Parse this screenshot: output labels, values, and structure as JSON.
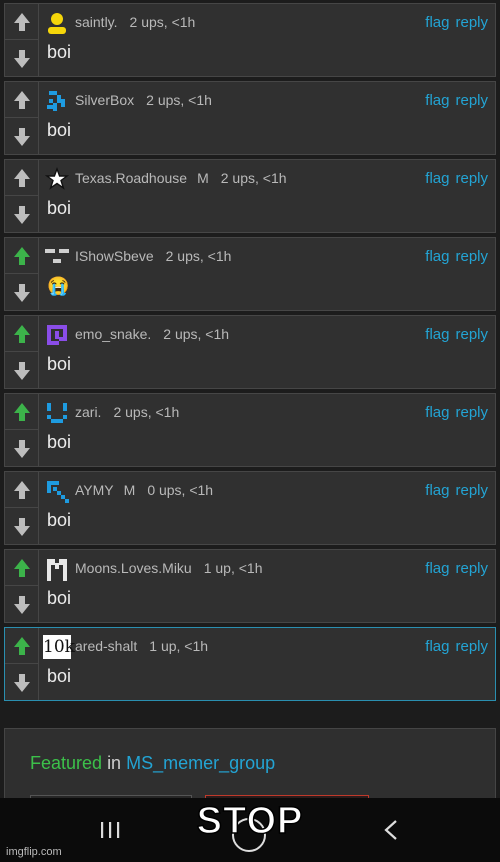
{
  "actions": {
    "flag": "flag",
    "reply": "reply"
  },
  "comments": [
    {
      "user": "saintly.",
      "mod": "",
      "ups": "2 ups, <1h",
      "text": "boi",
      "avatar": "yellow-person-icon",
      "upvoted": false,
      "highlight": false
    },
    {
      "user": "SilverBox",
      "mod": "",
      "ups": "2 ups, <1h",
      "text": "boi",
      "avatar": "blue-pixel-icon",
      "upvoted": false,
      "highlight": false
    },
    {
      "user": "Texas.Roadhouse",
      "mod": "M",
      "ups": "2 ups, <1h",
      "text": "boi",
      "avatar": "star-icon",
      "upvoted": false,
      "highlight": false
    },
    {
      "user": "IShowSbeve",
      "mod": "",
      "ups": "2 ups, <1h",
      "text": "😭",
      "avatar": "gray-pixel-icon",
      "upvoted": true,
      "highlight": false
    },
    {
      "user": "emo_snake.",
      "mod": "",
      "ups": "2 ups, <1h",
      "text": "boi",
      "avatar": "purple-pixel-icon",
      "upvoted": true,
      "highlight": false
    },
    {
      "user": "zari.",
      "mod": "",
      "ups": "2 ups, <1h",
      "text": "boi",
      "avatar": "blue-face-pixel-icon",
      "upvoted": true,
      "highlight": false
    },
    {
      "user": "AYMY",
      "mod": "M",
      "ups": "0 ups, <1h",
      "text": "boi",
      "avatar": "blue-arrow-pixel-icon",
      "upvoted": false,
      "highlight": false
    },
    {
      "user": "Moons.Loves.Miku",
      "mod": "",
      "ups": "1 up, <1h",
      "text": "boi",
      "avatar": "white-pixel-icon",
      "upvoted": true,
      "highlight": false
    },
    {
      "user": "ared-shalt",
      "mod": "",
      "ups": "1 up, <1h",
      "text": "boi",
      "avatar": "10k-icon",
      "avatar_text": "10k",
      "upvoted": true,
      "highlight": true
    }
  ],
  "featured": {
    "label": "Featured",
    "in": "in",
    "group": "MS_memer_group"
  },
  "caption": "STOP",
  "watermark": "imgflip.com",
  "colors": {
    "upvote": "#3cb34a",
    "vote_default": "#bdbdbd",
    "link": "#23a4d4",
    "highlight_border": "#2a8fb0"
  }
}
